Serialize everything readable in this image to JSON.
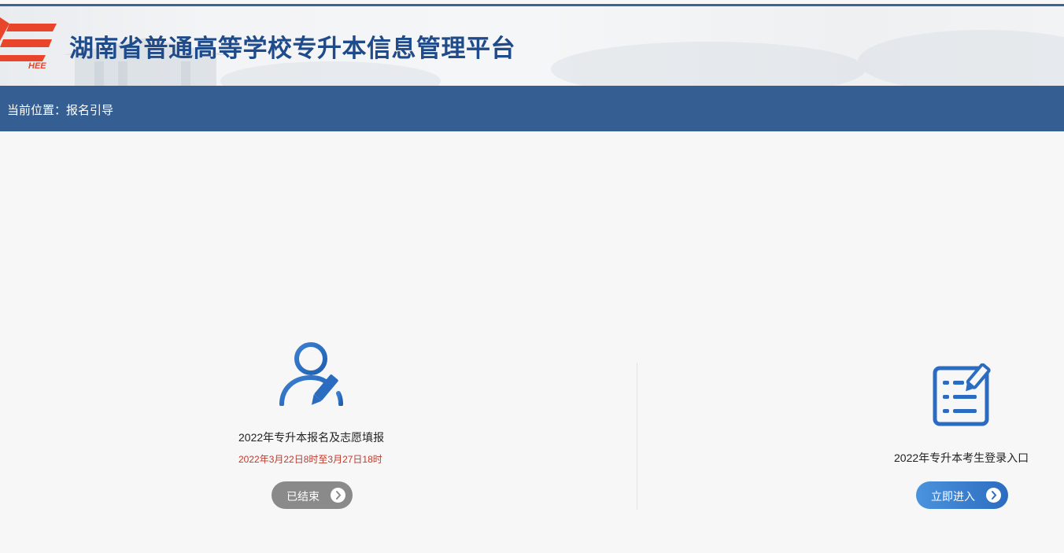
{
  "header": {
    "logo_text": "HEE",
    "title": "湖南省普通高等学校专升本信息管理平台"
  },
  "nav": {
    "breadcrumb": "当前位置：报名引导"
  },
  "panels": [
    {
      "icon": "user-edit-icon",
      "title": "2022年专升本报名及志愿填报",
      "date": "2022年3月22日8时至3月27日18时",
      "button_label": "已结束",
      "button_color": "#8a8a8a"
    },
    {
      "icon": "document-edit-icon",
      "title": "2022年专升本考生登录入口",
      "button_label": "立即进入",
      "button_color": "#3a7fd0"
    }
  ],
  "colors": {
    "accent": "#355f93",
    "title": "#1f4b8a",
    "logo": "#e8452a",
    "date": "#c0392b"
  }
}
